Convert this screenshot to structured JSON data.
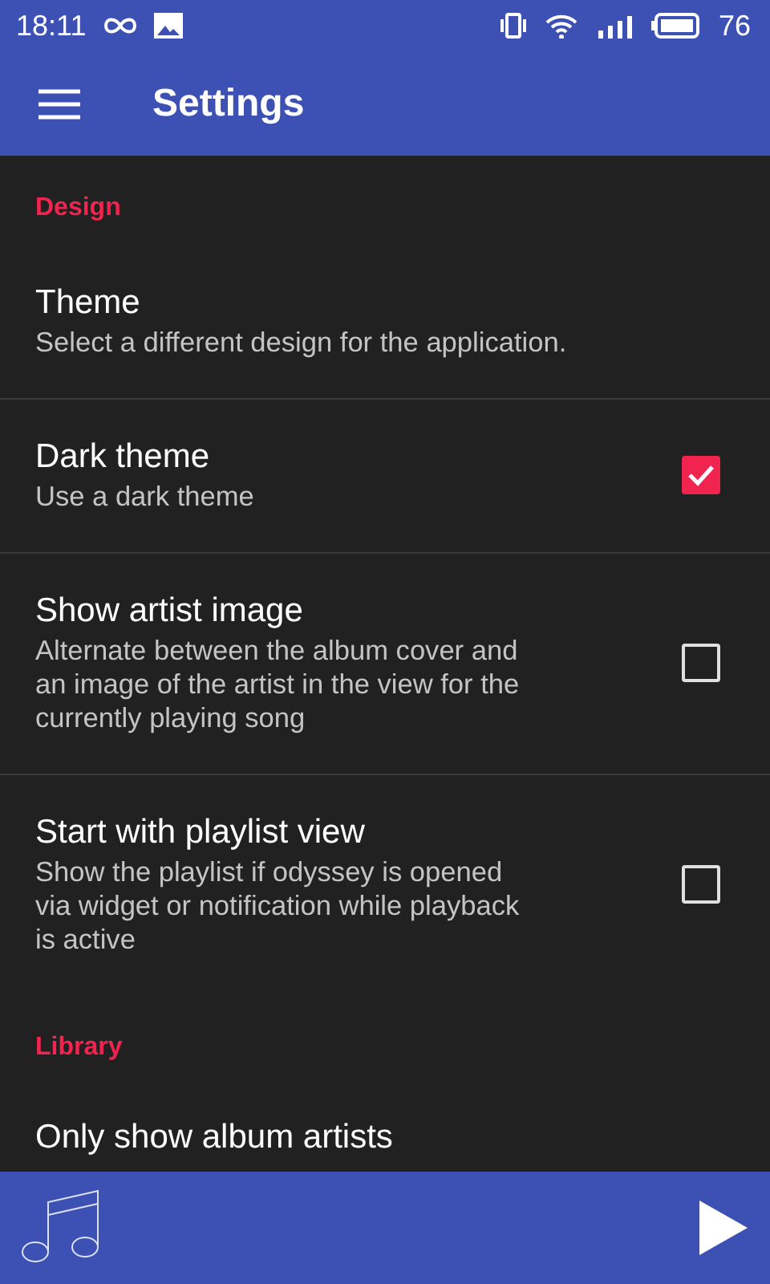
{
  "status_bar": {
    "time": "18:11",
    "battery": "76"
  },
  "toolbar": {
    "title": "Settings"
  },
  "settings": [
    {
      "kind": "category",
      "title": "Design"
    },
    {
      "kind": "plain",
      "title": "Theme",
      "summary": "Select a different design for the application."
    },
    {
      "kind": "checkbox",
      "title": "Dark theme",
      "summary": "Use a dark theme",
      "checked": true
    },
    {
      "kind": "checkbox",
      "title": "Show artist image",
      "summary": "Alternate between the album cover and an image of the artist in the view for the currently playing song",
      "checked": false
    },
    {
      "kind": "checkbox",
      "title": "Start with playlist view",
      "summary": "Show the playlist if odyssey is opened via widget or notification while playback is active",
      "checked": false
    },
    {
      "kind": "category",
      "title": "Library"
    },
    {
      "kind": "plain",
      "title": "Only show album artists"
    }
  ]
}
